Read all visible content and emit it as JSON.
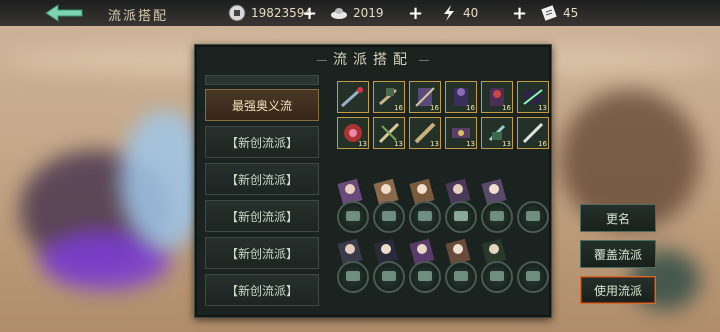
{
  "topbar": {
    "title": "流派搭配",
    "resources": [
      {
        "icon": "coin-icon",
        "value": "19823594"
      },
      {
        "icon": "ingot-icon",
        "value": "2019"
      },
      {
        "icon": "stamina-icon",
        "value": "40"
      },
      {
        "icon": "scroll-icon",
        "value": "45"
      }
    ]
  },
  "panel": {
    "title": "流派搭配",
    "schools": [
      {
        "label": "最强奥义流",
        "active": true
      },
      {
        "label": "【新创流派】",
        "active": false
      },
      {
        "label": "【新创流派】",
        "active": false
      },
      {
        "label": "【新创流派】",
        "active": false
      },
      {
        "label": "【新创流派】",
        "active": false
      },
      {
        "label": "【新创流派】",
        "active": false
      }
    ],
    "skills_row1": [
      "",
      "16",
      "16",
      "16",
      "16",
      "13"
    ],
    "skills_row2": [
      "13",
      "13",
      "13",
      "13",
      "13",
      "16"
    ]
  },
  "buttons": {
    "rename": "更名",
    "overwrite": "覆盖流派",
    "use": "使用流派"
  },
  "colors": {
    "panel_bg": "#1b2320",
    "accent_gold": "#c59b44",
    "use_border": "#d16a2a"
  }
}
